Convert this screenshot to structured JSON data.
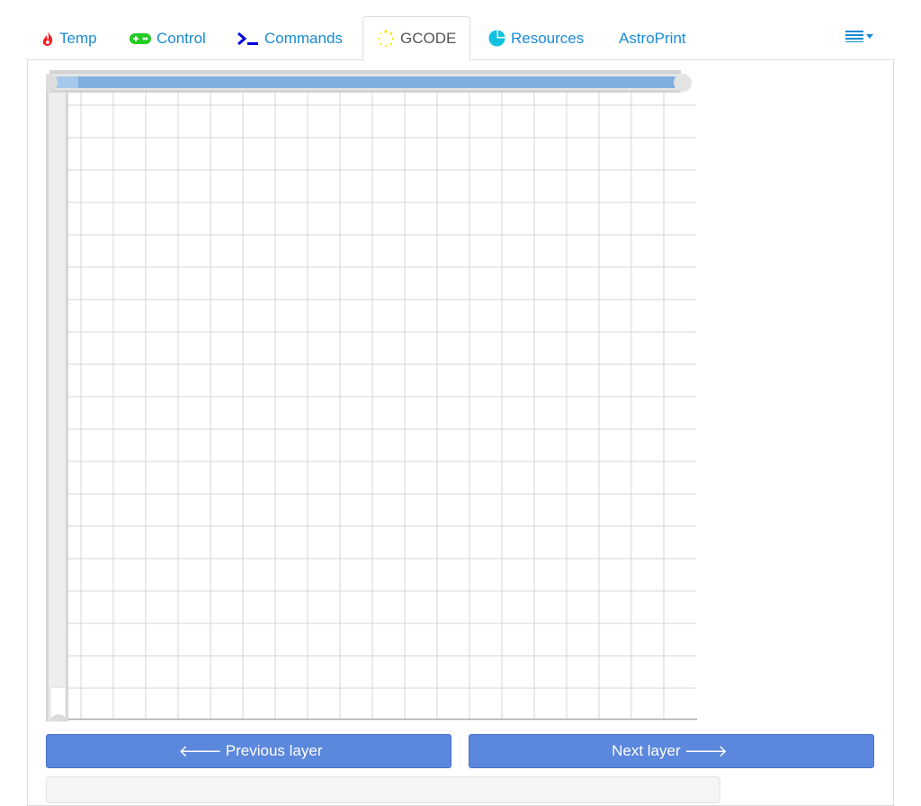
{
  "tabs": [
    {
      "label": "Temp",
      "icon": "flame-icon",
      "color": "#ff1a1a"
    },
    {
      "label": "Control",
      "icon": "gamepad-icon",
      "color": "#22cc22"
    },
    {
      "label": "Commands",
      "icon": "terminal-icon",
      "color": "#0000dd"
    },
    {
      "label": "GCODE",
      "icon": "spinner-icon",
      "color": "#f3e600",
      "active": true
    },
    {
      "label": "Resources",
      "icon": "pie-chart-icon",
      "color": "#11c2e0"
    },
    {
      "label": "AstroPrint",
      "icon": ""
    }
  ],
  "menu": {
    "icon": "list-menu-icon"
  },
  "viewer": {
    "layer_slider_icon": "vertical-slider",
    "progress_slider_icon": "horizontal-slider"
  },
  "buttons": {
    "previous": "Previous layer",
    "next": "Next layer"
  },
  "colors": {
    "link": "#1a8ad4",
    "button": "#5b87dd",
    "slider_fill": "#7fafde"
  }
}
